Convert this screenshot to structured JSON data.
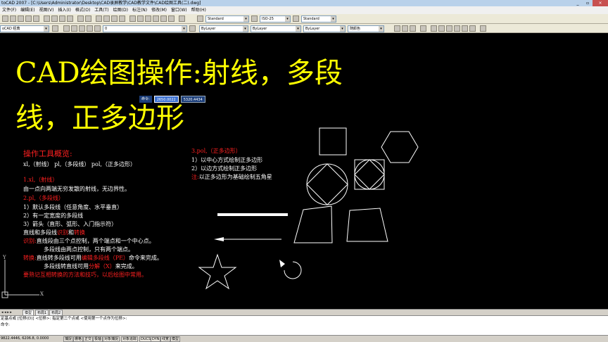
{
  "window": {
    "title": "toCAD 2007 - [C:\\Users\\Administrator\\Desktop\\CAD录屏教学\\CAD教学文件\\CAD绘图工具(二).dwg]",
    "controls": [
      "_",
      "▫",
      "×"
    ]
  },
  "menu": [
    "文件(F)",
    "编辑(E)",
    "视图(V)",
    "插入(I)",
    "格式(O)",
    "工具(T)",
    "绘图(D)",
    "标注(N)",
    "修改(M)",
    "窗口(W)",
    "帮助(H)"
  ],
  "toolbar": {
    "text_style": "Standard",
    "dim_style": "ISO-25",
    "table_style": "Standard",
    "workspace": "oCAD 经典",
    "layer": "0",
    "color": "ByLayer",
    "linetype": "ByLayer",
    "lineweight": "ByLayer",
    "plotstyle": "随颜色"
  },
  "canvas": {
    "title_line1": "CAD绘图操作:射线，多段",
    "title_line2": "线，正多边形",
    "tooltip_label": "命令:",
    "tooltip_x": "2650.0022",
    "tooltip_y": "5320.4434",
    "overview_heading": "操作工具概览:",
    "overview_items": "xl,（射线）    pl,（多段线）    pol,（正多边形）",
    "s1_title": "1.xl,（射线）",
    "s1_desc": "由一点向两端无穷发散的射线，无边界性。",
    "s2_title": "2.pl,（多段线）",
    "s2_item1": "1）默认多段线（任意角度、水平垂直）",
    "s2_item2": "2）有一定宽度的多段线",
    "s2_item3": "3）箭头（直形、弧形、入门指示符）",
    "s2_compare_a": "直线和多段线",
    "s2_compare_b": "识别",
    "s2_compare_c": "和",
    "s2_compare_d": "转换",
    "s2_identify_label": "识别:",
    "s2_identify_1": "直线段由三个点控制，两个端点和一个中心点。",
    "s2_identify_2": "多段线由两点控制，只有两个端点。",
    "s2_convert_label": "转换:",
    "s2_convert_1a": "直线转多段线可用",
    "s2_convert_1b": "编辑多段线（PE）",
    "s2_convert_1c": "命令来完成。",
    "s2_convert_2a": "多段线转直线可用",
    "s2_convert_2b": "分解（X）",
    "s2_convert_2c": "来完成。",
    "s2_note": "要熟记互相转换的方法和技巧，以后绘图中常用。",
    "s3_title": "3.pol,（正多边形）",
    "s3_item1": "1）以中心方式绘制正多边形",
    "s3_item2": "2）以边方式绘制正多边形",
    "s3_note_label": "注:",
    "s3_note": "以正多边形为基础绘制五角星",
    "ucs_y": "Y",
    "ucs_x": "X"
  },
  "layout_tabs": [
    "模型",
    "布局1",
    "布局2"
  ],
  "command": {
    "line1": "定基点或 [位移(D)] <位移>:  指定第二个点或 <使用第一个点作为位移>:",
    "line2": "命令:"
  },
  "status": {
    "coords": "9822.4446, 6206.8, 0.0000",
    "buttons": [
      "捕捉",
      "栅格",
      "正交",
      "极轴",
      "对象捕捉",
      "对象追踪",
      "DUCS",
      "DYN",
      "线宽",
      "模型"
    ]
  }
}
